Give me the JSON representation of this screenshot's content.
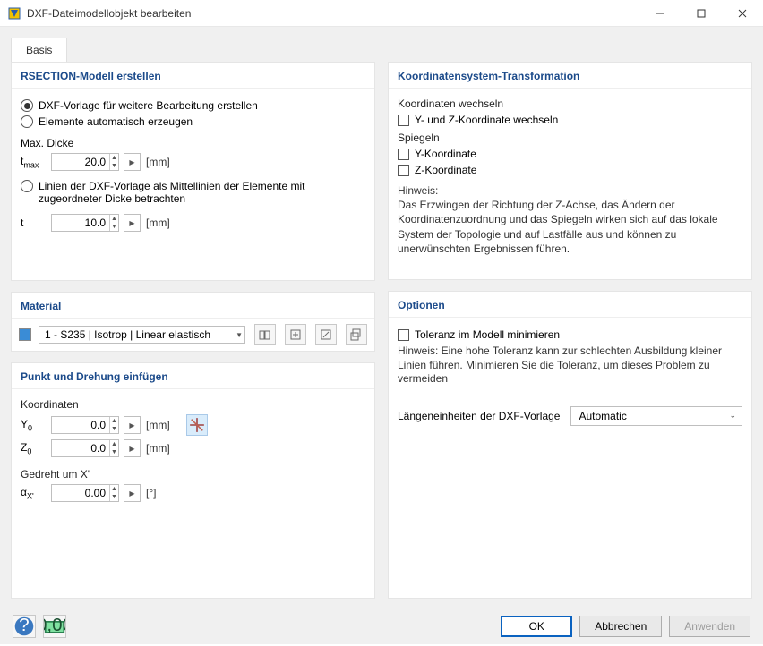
{
  "window": {
    "title": "DXF-Dateimodellobjekt bearbeiten"
  },
  "tabs": {
    "basis": "Basis"
  },
  "left": {
    "rsection": {
      "title": "RSECTION-Modell erstellen",
      "opt1": "DXF-Vorlage für weitere Bearbeitung erstellen",
      "opt2": "Elemente automatisch erzeugen",
      "maxdicke": "Max. Dicke",
      "tmax_label": "t",
      "tmax_sub": "max",
      "tmax_val": "20.0",
      "opt3a": "Linien der DXF-Vorlage als Mittellinien der Elemente mit",
      "opt3b": "zugeordneter Dicke betrachten",
      "t_label": "t",
      "t_val": "10.0",
      "unit_mm": "[mm]"
    },
    "material": {
      "title": "Material",
      "value": "1 - S235 | Isotrop | Linear elastisch"
    },
    "insert": {
      "title": "Punkt und Drehung einfügen",
      "koord": "Koordinaten",
      "y0_l": "Y",
      "y0_s": "0",
      "y0_v": "0.0",
      "z0_l": "Z",
      "z0_s": "0",
      "z0_v": "0.0",
      "unit_mm": "[mm]",
      "rot_h": "Gedreht um X'",
      "ax_l": "α",
      "ax_s": "X'",
      "ax_v": "0.00",
      "unit_deg": "[°]"
    }
  },
  "right": {
    "coord": {
      "title": "Koordinatensystem-Transformation",
      "h1": "Koordinaten wechseln",
      "c1": "Y- und Z-Koordinate wechseln",
      "h2": "Spiegeln",
      "c2": "Y-Koordinate",
      "c3": "Z-Koordinate",
      "note_h": "Hinweis:",
      "note": "Das Erzwingen der Richtung der Z-Achse, das Ändern der Koordinatenzuordnung und das Spiegeln wirken sich auf das lokale System der Topologie und auf Lastfälle aus und können zu unerwünschten Ergebnissen führen."
    },
    "opt": {
      "title": "Optionen",
      "c1": "Toleranz im Modell minimieren",
      "hint": "Hinweis: Eine hohe Toleranz kann zur schlechten Ausbildung kleiner Linien führen. Minimieren Sie die Toleranz, um dieses Problem zu vermeiden",
      "len_l": "Längeneinheiten der DXF-Vorlage",
      "len_v": "Automatic"
    }
  },
  "footer": {
    "ok": "OK",
    "cancel": "Abbrechen",
    "apply": "Anwenden"
  }
}
